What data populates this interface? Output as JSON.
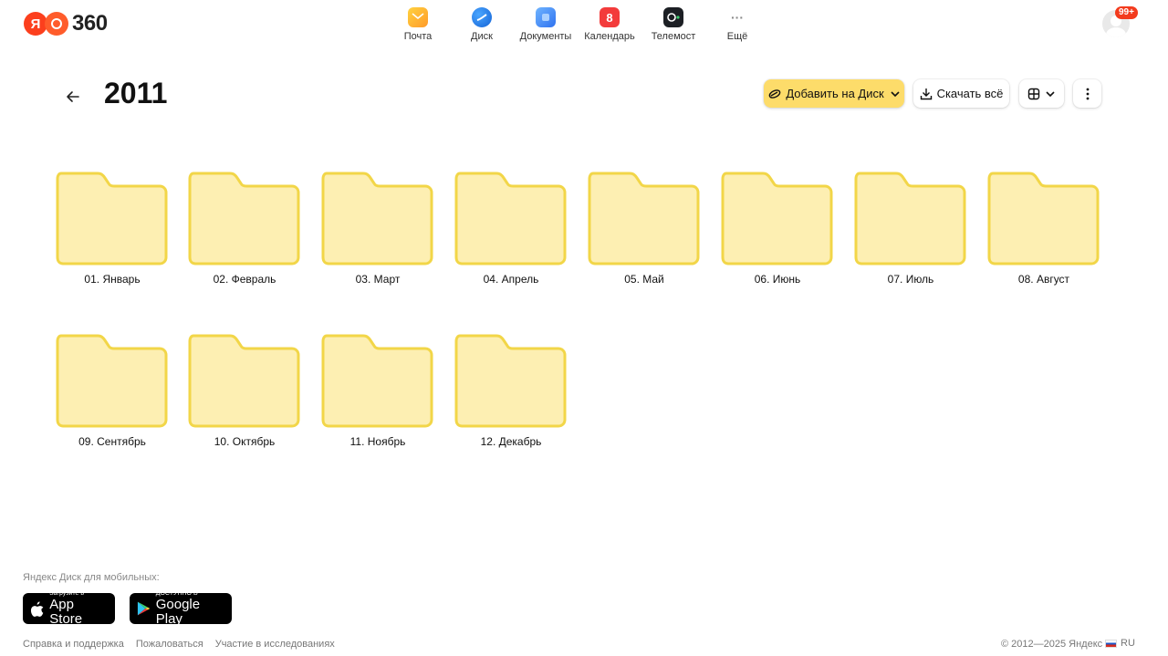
{
  "header": {
    "logo": {
      "ya": "Я",
      "three": "360"
    },
    "services": [
      {
        "label": "Почта",
        "icon": "mail-icon"
      },
      {
        "label": "Диск",
        "icon": "disk-icon"
      },
      {
        "label": "Документы",
        "icon": "documents-icon"
      },
      {
        "label": "Календарь",
        "icon": "calendar-icon",
        "glyph": "8"
      },
      {
        "label": "Телемост",
        "icon": "telemost-icon"
      },
      {
        "label": "Ещё",
        "icon": "more-icon",
        "glyph": "···"
      }
    ],
    "notifications_badge": "99+"
  },
  "toolbar": {
    "title": "2011",
    "add_label": "Добавить на Диск",
    "download_label": "Скачать всё"
  },
  "folders": [
    {
      "name": "01. Январь"
    },
    {
      "name": "02. Февраль"
    },
    {
      "name": "03. Март"
    },
    {
      "name": "04. Апрель"
    },
    {
      "name": "05. Май"
    },
    {
      "name": "06. Июнь"
    },
    {
      "name": "07. Июль"
    },
    {
      "name": "08. Август"
    },
    {
      "name": "09. Сентябрь"
    },
    {
      "name": "10. Октябрь"
    },
    {
      "name": "11. Ноябрь"
    },
    {
      "name": "12. Декабрь"
    }
  ],
  "footer": {
    "mobile_label": "Яндекс Диск для мобильных:",
    "app_store": {
      "small": "Загрузите в",
      "big": "App Store"
    },
    "google_play": {
      "small": "ДОСТУПНО В",
      "big": "Google Play"
    },
    "links": [
      "Справка и поддержка",
      "Пожаловаться",
      "Участие в исследованиях"
    ],
    "copyright": "© 2012—2025 Яндекс",
    "lang": "RU"
  },
  "colors": {
    "accent_button": "#fddc6a",
    "folder_fill": "#fdefb2",
    "folder_stroke": "#f2d648",
    "badge": "#f33b1d"
  }
}
